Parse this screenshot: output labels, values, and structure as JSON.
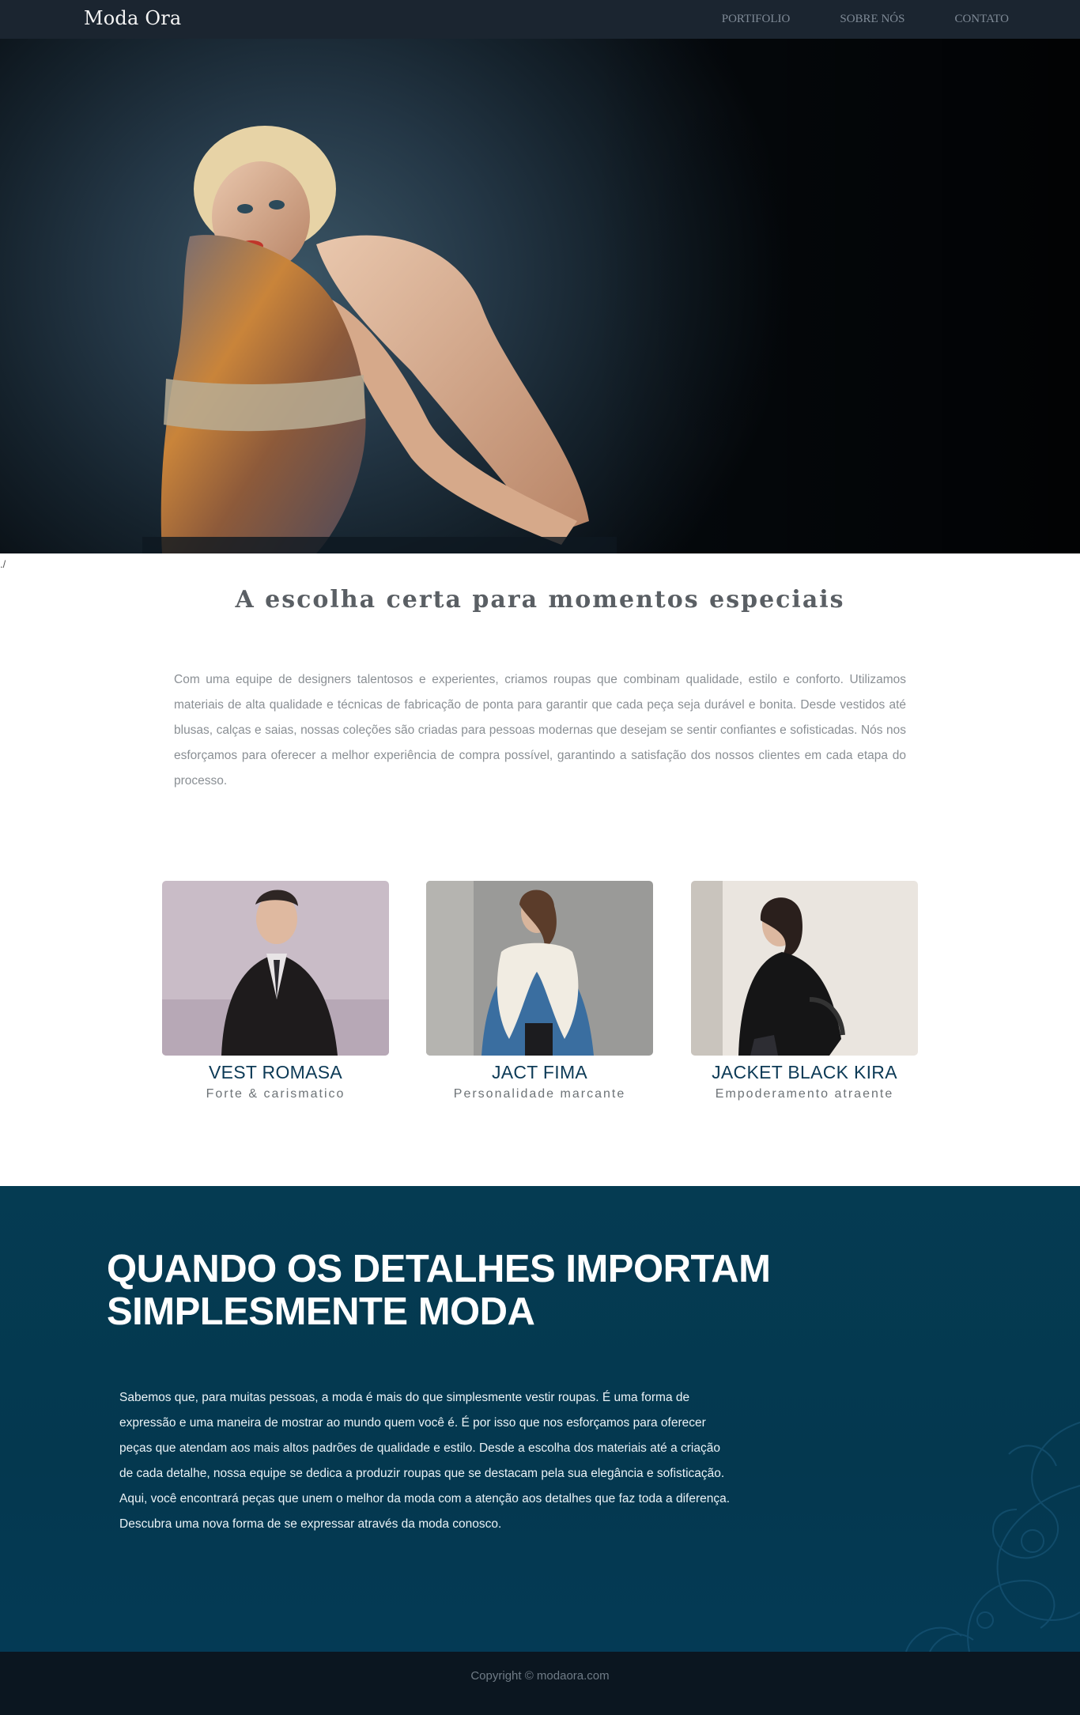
{
  "nav": {
    "brand": "Moda Ora",
    "links": [
      "PORTIFOLIO",
      "SOBRE NÓS",
      "CONTATO"
    ]
  },
  "hero": {
    "image_icon": "fashion-model-photo"
  },
  "stray_mark": "./",
  "intro": {
    "title": "A escolha certa para momentos especiais",
    "text": "Com uma equipe de designers talentosos e experientes, criamos roupas que combinam qualidade, estilo e conforto. Utilizamos materiais de alta qualidade e técnicas de fabricação de ponta para garantir que cada peça seja durável e bonita. Desde vestidos até blusas, calças e saias, nossas coleções são criadas para pessoas modernas que desejam se sentir confiantes e sofisticadas. Nós nos esforçamos para oferecer a melhor experiência de compra possível, garantindo a satisfação dos nossos clientes em cada etapa do processo."
  },
  "products": [
    {
      "name": "VEST ROMASA",
      "tagline": "Forte & carismatico"
    },
    {
      "name": "JACT FIMA",
      "tagline": "Personalidade marcante"
    },
    {
      "name": "JACKET BLACK KIRA",
      "tagline": "Empoderamento atraente"
    }
  ],
  "details": {
    "title_line1": "QUANDO OS DETALHES IMPORTAM",
    "title_line2": "SIMPLESMENTE MODA",
    "text": "Sabemos que, para muitas pessoas, a moda é mais do que simplesmente vestir roupas. É uma forma de expressão e uma maneira de mostrar ao mundo quem você é. É por isso que nos esforçamos para oferecer peças que atendam aos mais altos padrões de qualidade e estilo. Desde a escolha dos materiais até a criação de cada detalhe, nossa equipe se dedica a produzir roupas que se destacam pela sua elegância e sofisticação. Aqui, você encontrará peças que unem o melhor da moda com a atenção aos detalhes que faz toda a diferença. Descubra uma nova forma de se expressar através da moda conosco."
  },
  "footer": {
    "copyright": "Copyright © modaora.com"
  },
  "colors": {
    "navbar": "#1b2530",
    "accent": "#0c3a56",
    "details_bg": "#053b52",
    "footer": "#0b1620"
  }
}
